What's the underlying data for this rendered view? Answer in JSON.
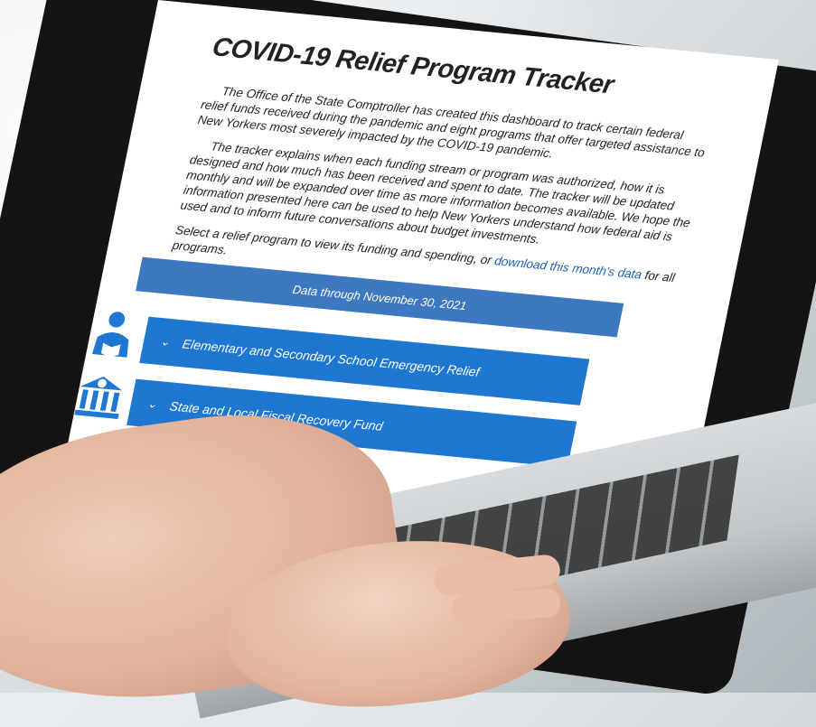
{
  "screen": {
    "title": "COVID-19 Relief Program Tracker",
    "paragraphs": [
      "The Office of the State Comptroller has created this dashboard to track certain federal relief funds received during the pandemic and eight programs that offer targeted assistance to New Yorkers most severely impacted by the COVID-19 pandemic.",
      "The tracker explains when each funding stream or program was authorized, how it is designed and how much has been received and spent to date. The tracker will be updated monthly and will be expanded over time as more information becomes available. We hope the information presented here can be used to help New Yorkers understand how federal aid is used and to inform future conversations about budget investments."
    ],
    "select_prefix": "Select a relief program to view its funding and spending, or ",
    "download_link": "download this month's data",
    "select_suffix": " for all programs.",
    "data_through": "Data through November 30, 2021",
    "programs": [
      {
        "label": "Elementary and Secondary School Emergency Relief",
        "icon": "student-reading-icon"
      },
      {
        "label": "State and Local Fiscal Recovery Fund",
        "icon": "government-building-icon"
      }
    ],
    "colors": {
      "program_bar": "#1e77d1",
      "data_bar": "#3d78c0",
      "link": "#1a5fb4"
    }
  }
}
